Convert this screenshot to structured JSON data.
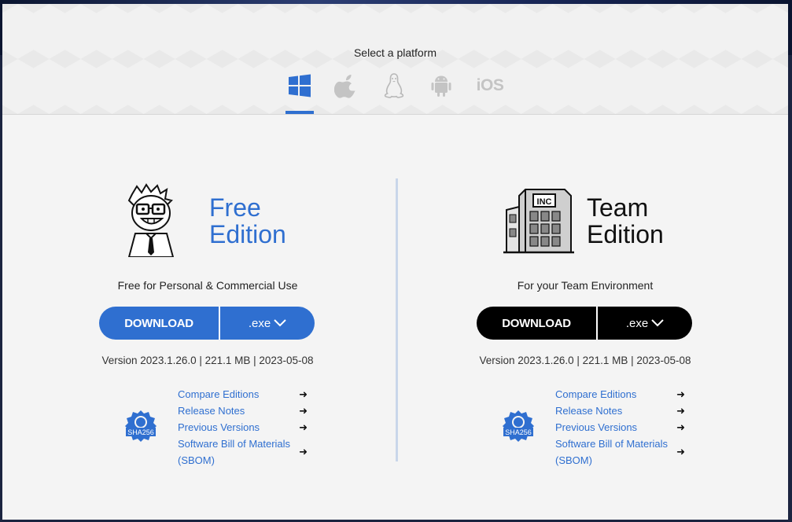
{
  "platform": {
    "title": "Select a platform",
    "items": [
      {
        "name": "windows-icon",
        "active": true
      },
      {
        "name": "apple-icon",
        "active": false
      },
      {
        "name": "linux-icon",
        "active": false
      },
      {
        "name": "android-icon",
        "active": false
      },
      {
        "name": "ios",
        "label": "iOS",
        "active": false
      }
    ]
  },
  "free": {
    "title_line1": "Free",
    "title_line2": "Edition",
    "tagline": "Free for Personal & Commercial Use",
    "download_label": "DOWNLOAD",
    "ext_label": ".exe",
    "version": "Version 2023.1.26.0 | 221.1 MB | 2023-05-08",
    "sha_label": "SHA256",
    "links": [
      "Compare Editions",
      "Release Notes",
      "Previous Versions",
      "Software Bill of Materials (SBOM)"
    ],
    "arrow": "➜"
  },
  "team": {
    "title_line1": "Team",
    "title_line2": "Edition",
    "tagline": "For your Team Environment",
    "download_label": "DOWNLOAD",
    "ext_label": ".exe",
    "version": "Version 2023.1.26.0 | 221.1 MB | 2023-05-08",
    "sha_label": "SHA256",
    "building_label": "INC",
    "links": [
      "Compare Editions",
      "Release Notes",
      "Previous Versions",
      "Software Bill of Materials (SBOM)"
    ],
    "arrow": "➜"
  },
  "colors": {
    "accent": "#2f6fd0",
    "team": "#000000",
    "background": "#f4f4f4"
  }
}
